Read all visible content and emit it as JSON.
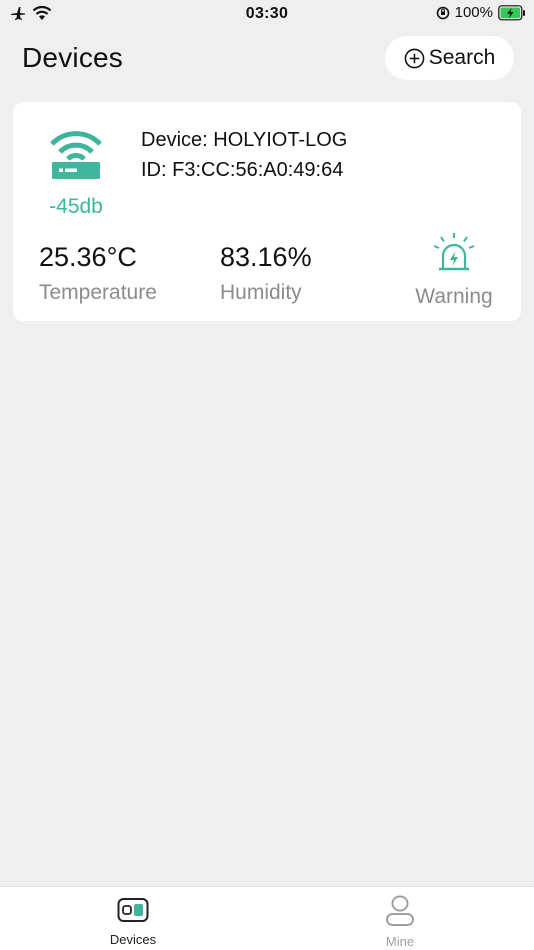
{
  "status_bar": {
    "time": "03:30",
    "battery_percent": "100%",
    "icons": [
      "airplane-icon",
      "wifi-icon",
      "orientation-lock-icon",
      "battery-charging-icon"
    ]
  },
  "header": {
    "title": "Devices",
    "search_label": "Search"
  },
  "device": {
    "name": "Device: HOLYIOT-LOG",
    "id": "ID: F3:CC:56:A0:49:64",
    "signal": "-45db",
    "temperature_value": "25.36°C",
    "temperature_label": "Temperature",
    "humidity_value": "83.16%",
    "humidity_label": "Humidity",
    "warning_label": "Warning"
  },
  "tabs": [
    {
      "label": "Devices",
      "active": true
    },
    {
      "label": "Mine",
      "active": false
    }
  ],
  "colors": {
    "accent": "#3fb59d",
    "background": "#efefef",
    "card": "#ffffff",
    "muted_text": "#8c8c8c",
    "battery": "#34c759"
  }
}
